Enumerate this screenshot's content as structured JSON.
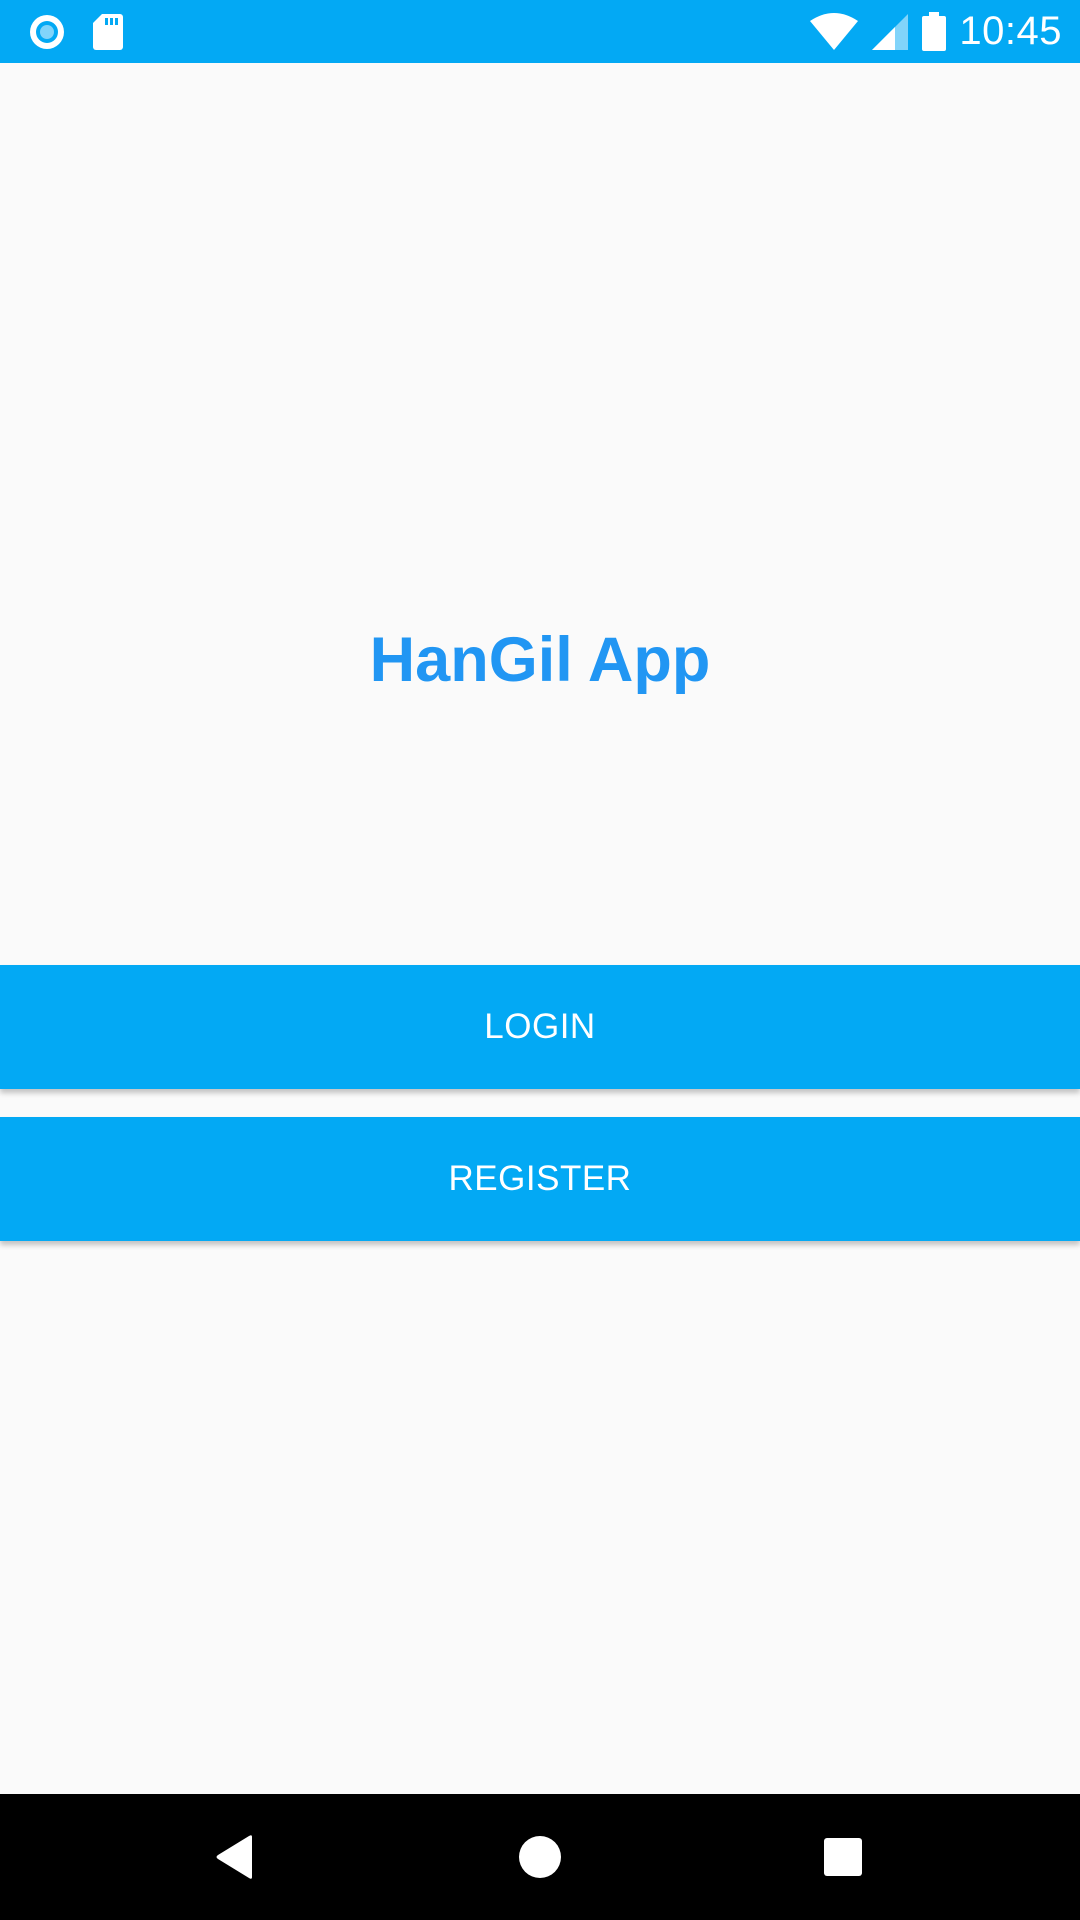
{
  "status_bar": {
    "time": "10:45",
    "left_icons": [
      "record-icon",
      "sd-card-icon"
    ],
    "right_icons": [
      "wifi-icon",
      "signal-icon",
      "battery-icon"
    ],
    "background_color": "#03a9f4"
  },
  "main": {
    "title": "HanGil App",
    "title_color": "#2196f3",
    "login_label": "LOGIN",
    "register_label": "REGISTER",
    "button_color": "#03a9f4"
  },
  "nav_bar": {
    "icons": [
      "back-icon",
      "home-icon",
      "recents-icon"
    ]
  }
}
